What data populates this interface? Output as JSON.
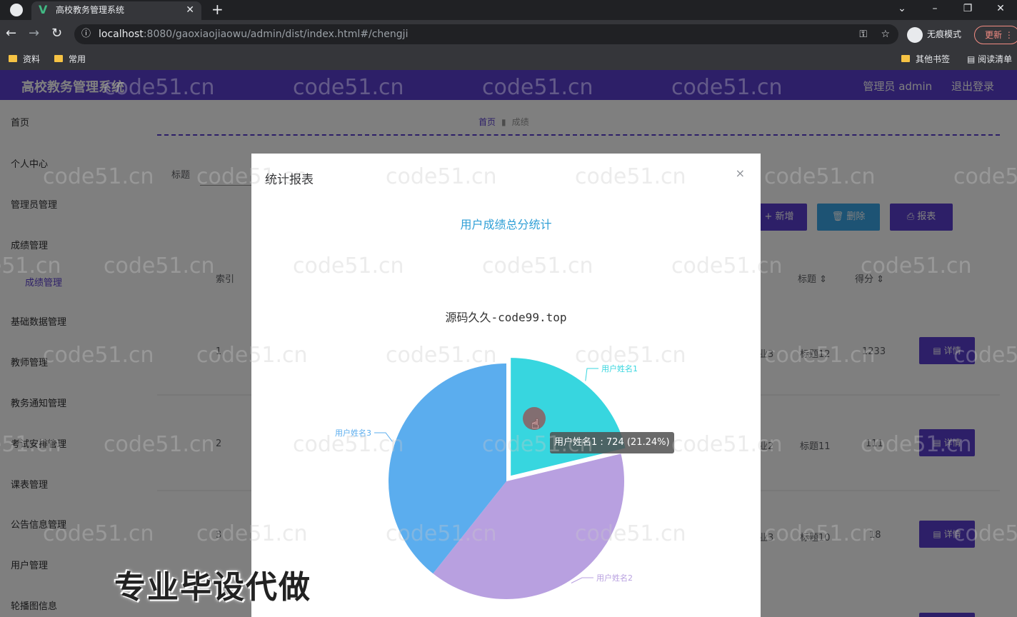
{
  "browser": {
    "tab_title": "高校教务管理系统",
    "tab_logo": "V",
    "tab_close": "✕",
    "new_tab": "+",
    "url_host": "localhost",
    "url_rest": ":8080/gaoxiaojiaowu/admin/dist/index.html#/chengji",
    "incognito_label": "无痕模式",
    "update_label": "更新",
    "bookmarks": [
      "资料",
      "常用"
    ],
    "other_bookmarks": "其他书签",
    "reading_list": "阅读清单"
  },
  "app": {
    "title": "高校教务管理系统",
    "user_label": "管理员 admin",
    "logout_label": "退出登录"
  },
  "sidebar": {
    "items": [
      "首页",
      "个人中心",
      "管理员管理",
      "成绩管理",
      "成绩管理",
      "基础数据管理",
      "教师管理",
      "教务通知管理",
      "考试安排管理",
      "课表管理",
      "公告信息管理",
      "用户管理",
      "轮播图信息"
    ]
  },
  "content": {
    "breadcrumb_home": "首页",
    "breadcrumb_current": "成绩",
    "search_label": "标题",
    "add_button": "新增",
    "delete_button": "删除",
    "report_button": "报表",
    "columns": [
      "索引",
      "标题",
      "得分"
    ],
    "rows": [
      {
        "index": "1",
        "partial": "业3",
        "title": "标题12",
        "score": "1233"
      },
      {
        "index": "2",
        "partial": "业2",
        "title": "标题11",
        "score": "111"
      },
      {
        "index": "3",
        "partial": "业3",
        "title": "标题10",
        "score": "18"
      }
    ],
    "detail_button": "详情"
  },
  "modal": {
    "title": "统计报表",
    "close": "×",
    "heading": "用户成绩总分统计",
    "tooltip": "用户姓名1 : 724 (21.24%)"
  },
  "chart_data": {
    "type": "pie",
    "title": "源码久久-code99.top",
    "categories": [
      "用户姓名1",
      "用户姓名2",
      "用户姓名3"
    ],
    "values": [
      724,
      1345,
      1340
    ],
    "colors": [
      "#37d6df",
      "#b8a0e0",
      "#5badee"
    ],
    "highlighted": "用户姓名1"
  },
  "overlay_caption": "专业毕设代做",
  "watermark_text": "code51.cn"
}
